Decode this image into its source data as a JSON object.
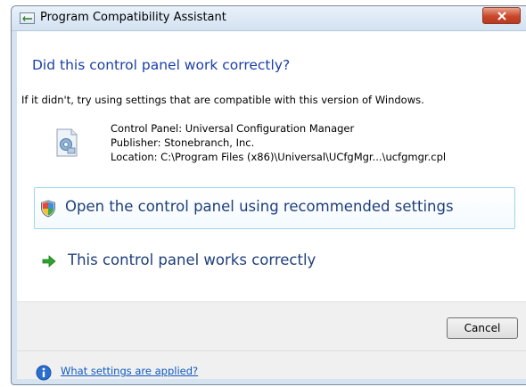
{
  "window": {
    "title": "Program Compatibility Assistant"
  },
  "dialog": {
    "heading": "Did this control panel work correctly?",
    "description": "If it didn't, try using settings that are compatible with this version of Windows.",
    "program": {
      "name_line": "Control Panel: Universal Configuration Manager",
      "publisher_line": "Publisher: Stonebranch, Inc.",
      "location_line": "Location: C:\\Program Files (x86)\\Universal\\UCfgMgr...\\ucfgmgr.cpl"
    },
    "options": [
      {
        "label": "Open the control panel using recommended settings",
        "icon": "shield-icon"
      },
      {
        "label": "This control panel works correctly",
        "icon": "green-arrow-icon"
      }
    ],
    "cancel_label": "Cancel",
    "help_link": "What settings are applied?"
  },
  "colors": {
    "heading": "#1c3fa8",
    "option_text": "#1f3f7a",
    "link": "#0e59c1",
    "close_button": "#c9472a",
    "arrow": "#2fa32f"
  }
}
